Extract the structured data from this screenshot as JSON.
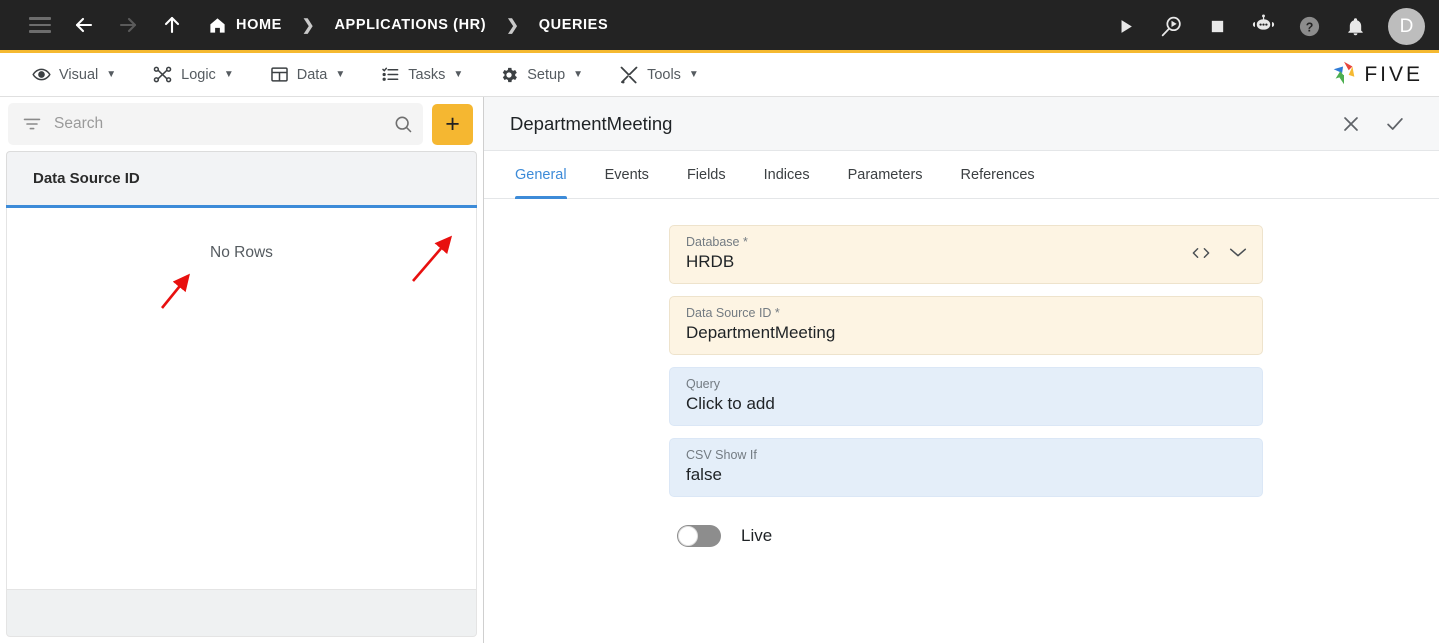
{
  "topbar": {
    "menu_icon": "hamburger-menu-icon",
    "back_icon": "arrow-back-icon",
    "forward_icon": "arrow-forward-icon",
    "up_icon": "arrow-up-icon",
    "breadcrumbs": [
      {
        "label": "HOME",
        "icon": "home-icon"
      },
      {
        "label": "APPLICATIONS (HR)",
        "icon": ""
      },
      {
        "label": "QUERIES",
        "icon": ""
      }
    ],
    "separator": "❯",
    "actions": [
      {
        "name": "run-icon",
        "glyph": "▶"
      },
      {
        "name": "debug-icon",
        "glyph": ""
      },
      {
        "name": "stop-icon",
        "glyph": "■"
      },
      {
        "name": "assistant-bot-icon",
        "glyph": ""
      },
      {
        "name": "help-icon",
        "glyph": "?"
      },
      {
        "name": "notifications-bell-icon",
        "glyph": ""
      }
    ],
    "avatar_initial": "D",
    "accent_color": "#F5B931",
    "bar_color": "#232323"
  },
  "menubar": {
    "items": [
      {
        "label": "Visual",
        "icon": "eye-icon",
        "caret": "▼"
      },
      {
        "label": "Logic",
        "icon": "logic-nodes-icon",
        "caret": "▼"
      },
      {
        "label": "Data",
        "icon": "table-grid-icon",
        "caret": "▼"
      },
      {
        "label": "Tasks",
        "icon": "checklist-icon",
        "caret": "▼"
      },
      {
        "label": "Setup",
        "icon": "gear-icon",
        "caret": "▼"
      },
      {
        "label": "Tools",
        "icon": "tools-wrench-icon",
        "caret": "▼"
      }
    ],
    "logo_text": "FIVE",
    "logo_colors": [
      "#4CAF50",
      "#2F7BD6",
      "#E8453C",
      "#F5B931"
    ]
  },
  "sidebar": {
    "search": {
      "placeholder": "Search",
      "value": "",
      "filter_icon": "filter-icon",
      "search_icon": "search-icon"
    },
    "add_button": {
      "label": "+",
      "color": "#F5B731"
    },
    "grid": {
      "columns": [
        "Data Source ID"
      ],
      "rows": [],
      "empty_text": "No Rows",
      "underline_color": "#3D8BD8"
    }
  },
  "detail": {
    "title": "DepartmentMeeting",
    "close_label": "✕",
    "confirm_label": "✓",
    "tabs": [
      {
        "label": "General",
        "active": true
      },
      {
        "label": "Events",
        "active": false
      },
      {
        "label": "Fields",
        "active": false
      },
      {
        "label": "Indices",
        "active": false
      },
      {
        "label": "Parameters",
        "active": false
      },
      {
        "label": "References",
        "active": false
      }
    ],
    "fields": [
      {
        "label": "Database *",
        "value": "HRDB",
        "style": "cream",
        "icons": [
          "code-icon",
          "chevron-down-icon"
        ]
      },
      {
        "label": "Data Source ID *",
        "value": "DepartmentMeeting",
        "style": "cream",
        "icons": []
      },
      {
        "label": "Query",
        "value": "Click to add",
        "style": "blue",
        "icons": []
      },
      {
        "label": "CSV Show If",
        "value": "false",
        "style": "blue",
        "icons": []
      }
    ],
    "toggle": {
      "label": "Live",
      "on": false
    }
  },
  "annotations": {
    "arrow_color": "#E8100F",
    "arrows": [
      {
        "name": "arrow-to-add-button"
      },
      {
        "name": "arrow-to-query-field"
      }
    ]
  }
}
